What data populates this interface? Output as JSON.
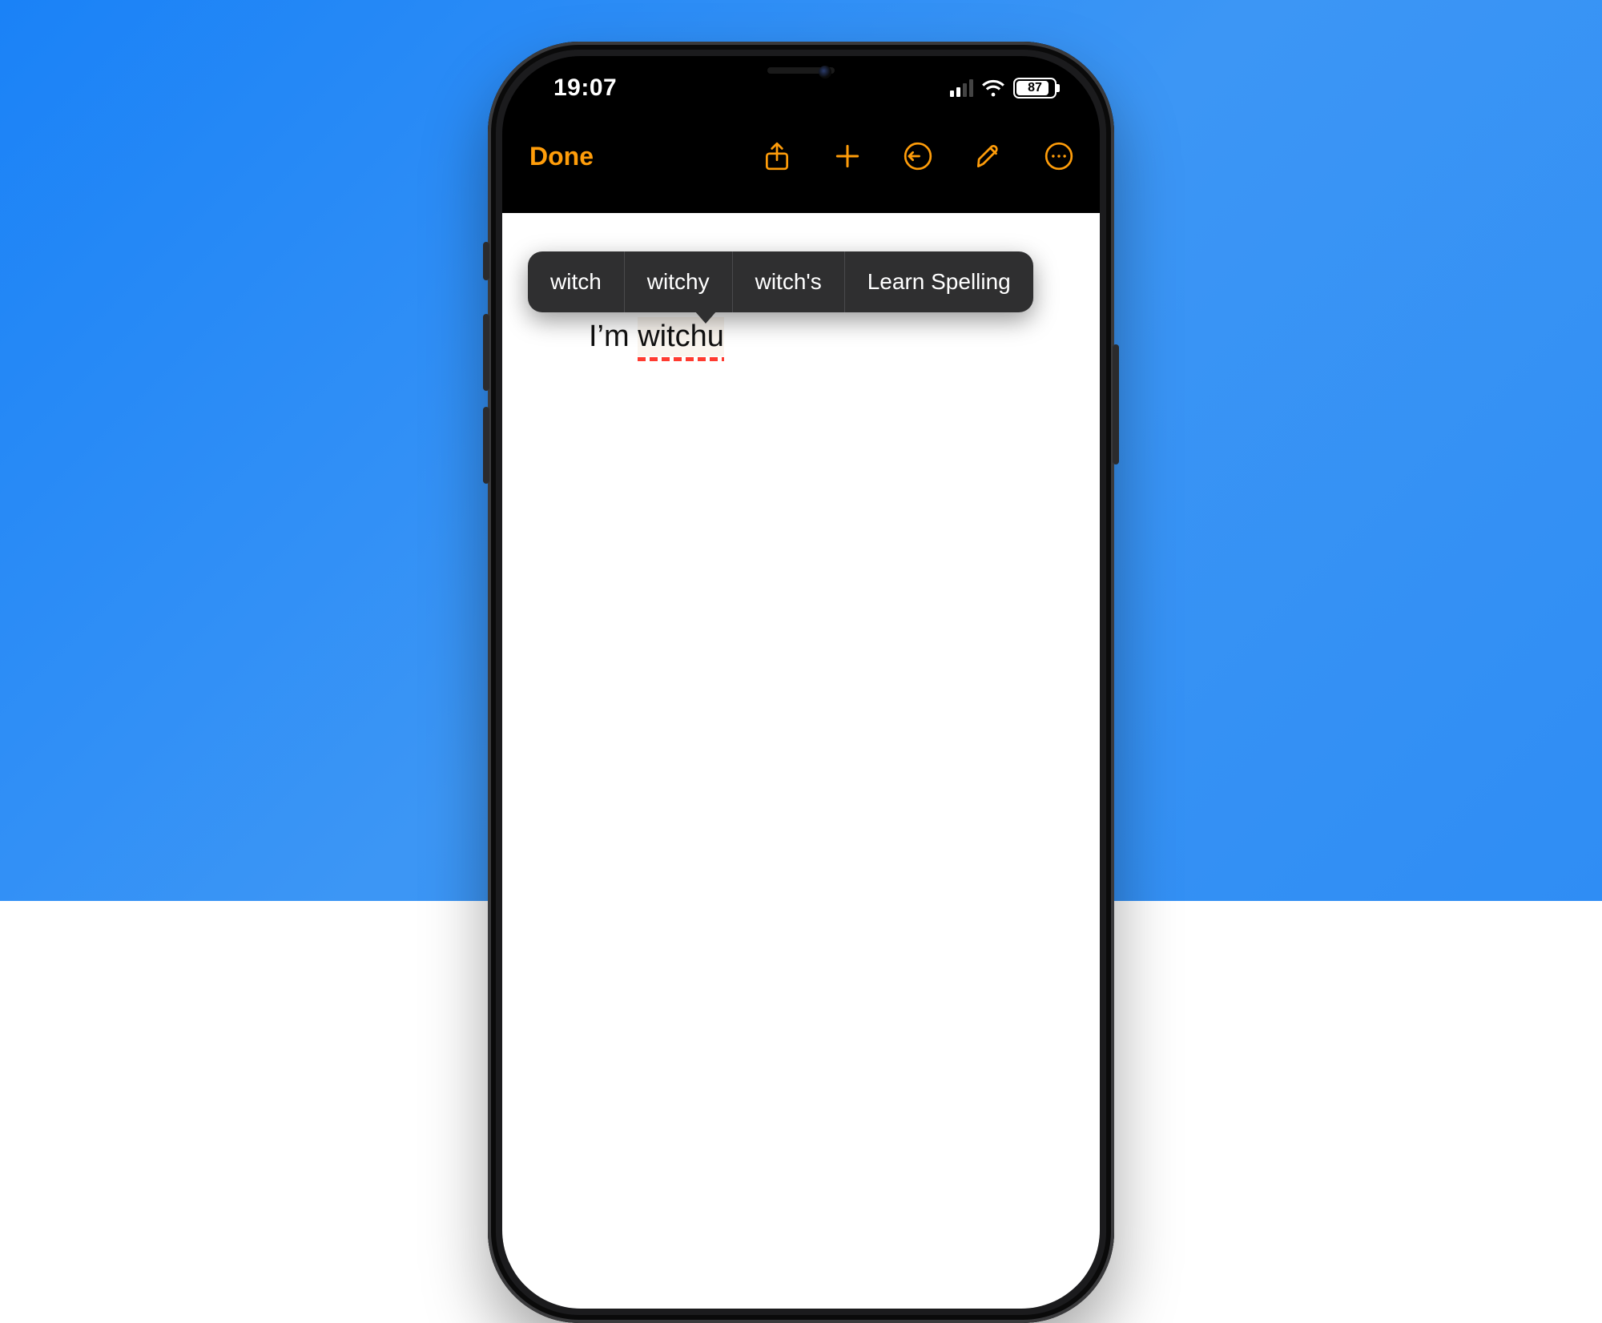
{
  "status": {
    "time": "19:07",
    "battery_percent": "87",
    "battery_fill_pct": 87,
    "signal_bars_on": 2,
    "signal_bars_total": 4
  },
  "nav": {
    "done_label": "Done"
  },
  "popover": {
    "suggestions": [
      "witch",
      "witchy",
      "witch's"
    ],
    "learn_label": "Learn Spelling"
  },
  "document": {
    "prefix": "I’m ",
    "misspelled_word": "witchu"
  },
  "colors": {
    "accent": "#ff9d0a",
    "error_underline": "#ff3b30",
    "popover_bg": "#2f2f30"
  }
}
